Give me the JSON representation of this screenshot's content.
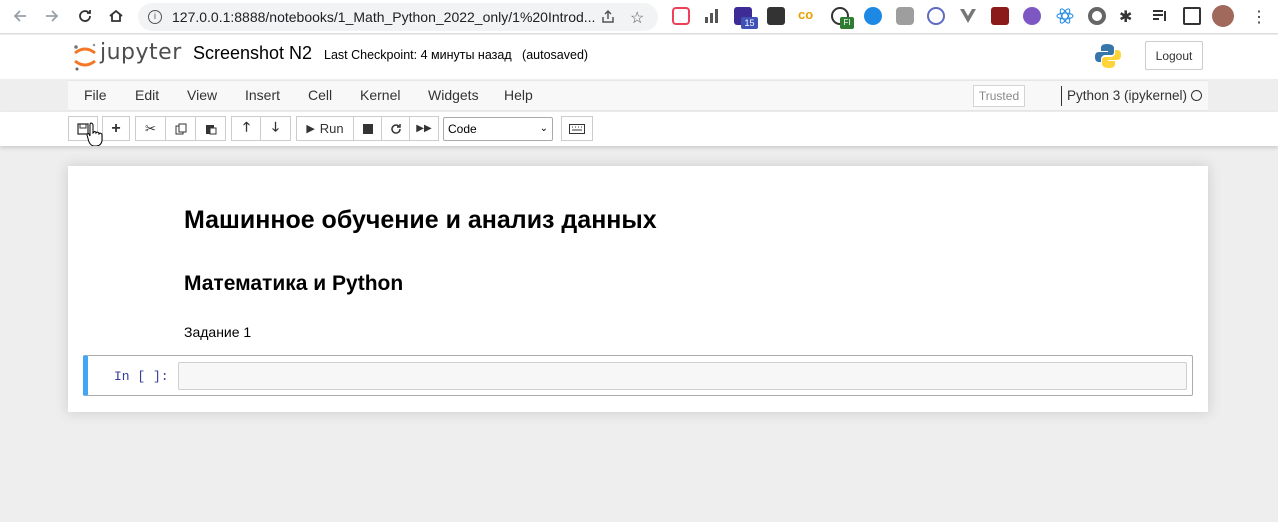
{
  "browser": {
    "url": "127.0.0.1:8888/notebooks/1_Math_Python_2022_only/1%20Introd...",
    "ext_badge_count": "15",
    "ext_badge_fi": "FI"
  },
  "header": {
    "logo_text": "jupyter",
    "notebook_title": "Screenshot N2",
    "checkpoint": "Last Checkpoint: 4 минуты назад",
    "autosave": "(autosaved)",
    "logout_label": "Logout"
  },
  "menubar": {
    "items": [
      {
        "label": "File"
      },
      {
        "label": "Edit"
      },
      {
        "label": "View"
      },
      {
        "label": "Insert"
      },
      {
        "label": "Cell"
      },
      {
        "label": "Kernel"
      },
      {
        "label": "Widgets"
      },
      {
        "label": "Help"
      }
    ],
    "trusted_label": "Trusted",
    "kernel_name": "Python 3 (ipykernel)"
  },
  "toolbar": {
    "run_label": "Run",
    "cell_type": "Code"
  },
  "notebook": {
    "heading1": "Машинное обучение и анализ данных",
    "heading2": "Математика и Python",
    "paragraph": "Задание 1",
    "cell_prompt": "In [ ]:"
  },
  "colors": {
    "cell_selected": "#42a5f5",
    "prompt": "#303f9f",
    "jupyter_orange": "#f37726"
  }
}
